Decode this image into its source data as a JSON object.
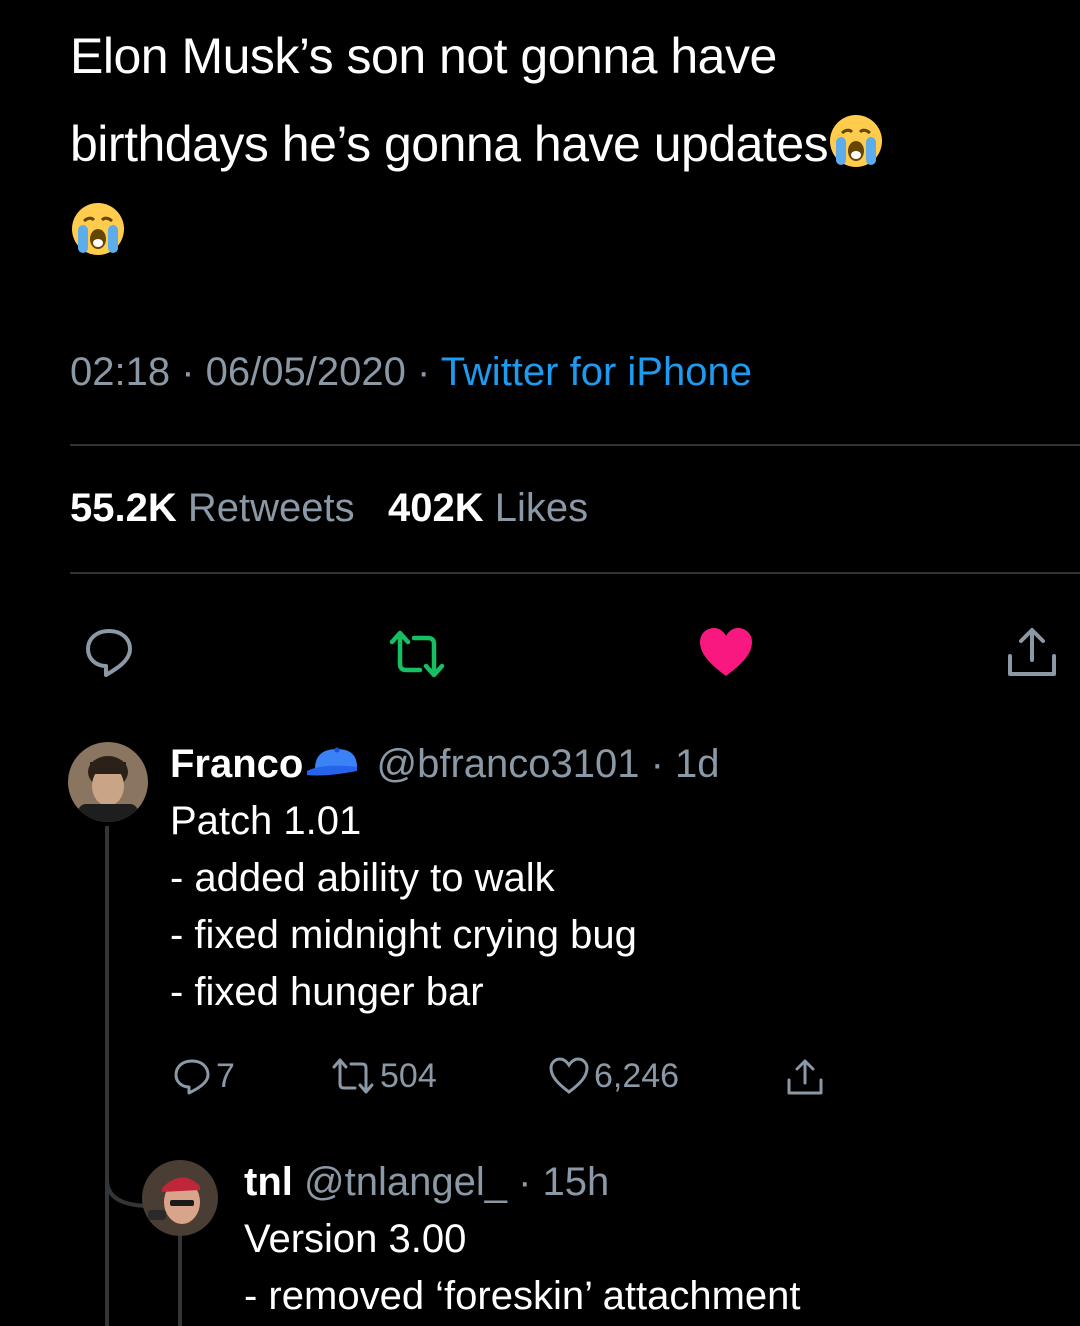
{
  "tweet": {
    "line1": "Elon Musk’s son not gonna have",
    "line2": "birthdays he’s gonna have updates",
    "emoji": "loudly-crying-face"
  },
  "meta": {
    "time": "02:18",
    "date": "06/05/2020",
    "sep": " · ",
    "source": "Twitter for iPhone"
  },
  "stats": {
    "retweets_count": "55.2K",
    "retweets_label": "Retweets",
    "likes_count": "402K",
    "likes_label": "Likes"
  },
  "actions": {
    "reply_icon": "reply-icon",
    "retweet_icon": "retweet-icon",
    "like_icon": "heart-icon",
    "share_icon": "share-icon",
    "retweet_color": "#17bf63",
    "like_color": "#f91880"
  },
  "replies": [
    {
      "name": "Franco",
      "badge": "blue-cap-emoji",
      "handle": "@bfranco3101",
      "time": "· 1d",
      "lines": [
        "Patch 1.01",
        "- added ability to walk",
        "- fixed midnight crying bug",
        "- fixed hunger bar"
      ],
      "reply_count": "7",
      "retweet_count": "504",
      "like_count": "6,246"
    },
    {
      "name": "tnl",
      "handle": "@tnlangel_",
      "time": "· 15h",
      "lines": [
        "Version 3.00",
        "- removed ‘foreskin’ attachment"
      ]
    }
  ],
  "colors": {
    "background": "#000000",
    "muted": "#8b98a5",
    "accent": "#1d9bf0"
  }
}
